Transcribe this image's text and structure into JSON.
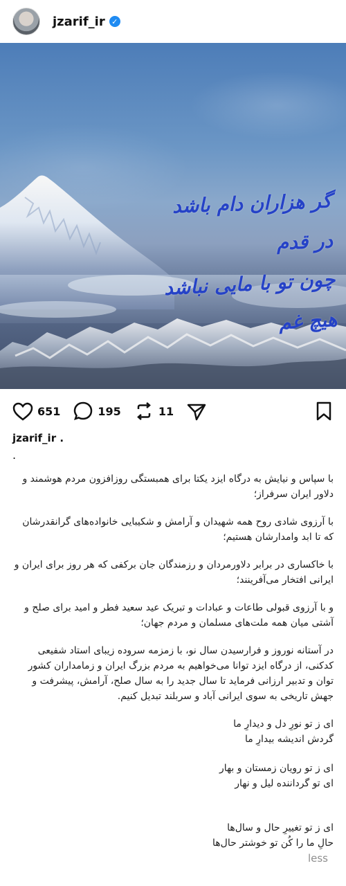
{
  "post": {
    "username": "jzarif_ir",
    "verified_icon": "verified-badge-icon",
    "image": {
      "calligraphy_line1": "گر هزاران دام باشد در قدم",
      "calligraphy_line2": "چون تو با مایی نباشد هیچ غم"
    },
    "stats": {
      "likes": "651",
      "comments": "195",
      "reposts": "11"
    },
    "caption": {
      "owner": "jzarif_ir .",
      "dot": ".",
      "paragraphs": [
        "با سپاس و نیایش به درگاه ایزد یکتا برای همبستگی روزافزون مردم هوشمند و دلاور ایران سرفراز؛",
        "با آرزوی شادی روح همه شهیدان و آرامش و شکیبایی خانواده‌های گرانقدرشان که تا ابد وامدارشان هستیم؛",
        "با خاکساری در برابر دلاورمردان و رزمندگان جان برکفی که هر روز برای ایران و ایرانی افتخار می‌آفرینند؛",
        "و با آرزوی قبولی طاعات و عبادات و تبریک عید سعید فطر و امید برای صلح و آشتی میان همه ملت‌های مسلمان و مردم جهان؛",
        "در آستانه نوروز و فرارسیدن سال نو، با زمزمه سروده زیبای استاد شفیعی کدکنی، از درگاه ایزد توانا می‌خواهیم به مردم بزرگ ایران و زمامداران کشور توان و تدبیر ارزانی فرماید تا سال جدید را به سال صلح، آرامش، پیشرفت و جهش تاریخی به سوی ایرانی آباد و سربلند تبدیل کنیم."
      ],
      "poem": [
        "ای ز تو نورِ دل و دیدارِ ما\nگردش اندیشه بیدارِ ما",
        "ای ز تو رویان زمستان و بهار\nای تو گرداننده لیل و نهار",
        "ای ز تو تغییرِ حال و سال‌ها\nحالِ ما را کُن تو خوشتر حال‌ها"
      ],
      "less_label": "less"
    }
  }
}
